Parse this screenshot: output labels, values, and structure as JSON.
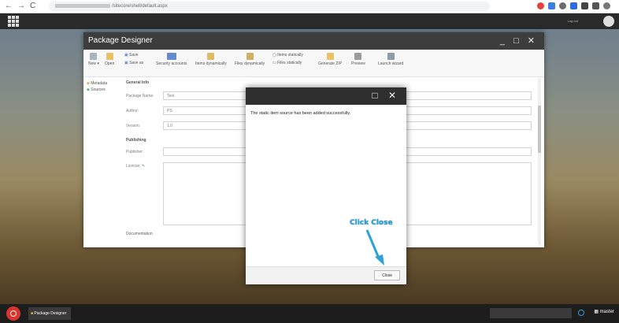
{
  "browser": {
    "back": "←",
    "forward": "→",
    "reload": "C",
    "url": "/sitecore/shell/default.aspx"
  },
  "header": {
    "logout": "Log out"
  },
  "window": {
    "title": "Package Designer",
    "controls": "_ □ ✕"
  },
  "ribbon": {
    "new": "New",
    "open": "Open",
    "save": "Save",
    "save_as": "Save as",
    "security_accounts": "Security accounts",
    "items_dynamically": "Items dynamically",
    "files_dynamically": "Files dynamically",
    "items_statically": "Items statically",
    "files_statically": "Files statically",
    "generate_zip": "Generate ZIP",
    "preview": "Preview",
    "launch_wizard": "Launch wizard"
  },
  "left_nav": {
    "metadata": "Metadata",
    "sources": "Sources"
  },
  "form": {
    "general_info": "General Info",
    "package_name_label": "Package Name:",
    "package_name_value": "Test",
    "author_label": "Author:",
    "author_value": "PS",
    "version_label": "Version:",
    "version_value": "1.0",
    "publishing": "Publishing",
    "publisher_label": "Publisher:",
    "license_label": "License:",
    "documentation": "Documentation"
  },
  "dialog": {
    "controls": "□ ✕",
    "message": "The static item source has been added successfully.",
    "close_label": "Close"
  },
  "callout": {
    "text": "Click Close"
  },
  "taskbar": {
    "task": "Package Designer",
    "database": "master"
  },
  "colors": {
    "accent": "#2ba3d9",
    "brand_red": "#d9352c",
    "title_bar": "#3d3d3d"
  }
}
